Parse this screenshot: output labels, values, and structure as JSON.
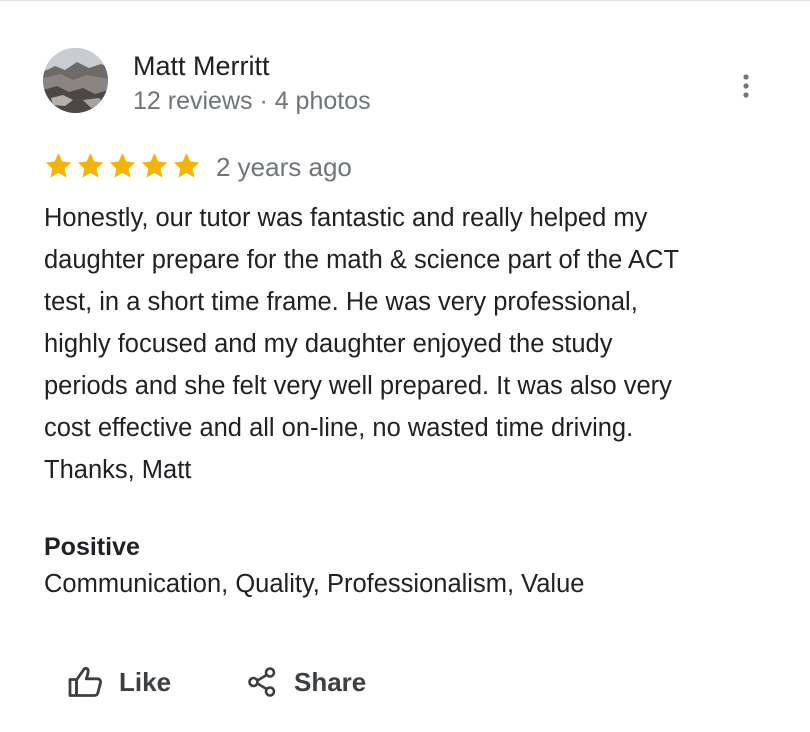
{
  "review": {
    "author": {
      "name": "Matt Merritt",
      "meta": "12 reviews · 4 photos"
    },
    "rating": 5,
    "max_rating": 5,
    "time": "2 years ago",
    "text": "Honestly, our tutor was fantastic and really helped my\ndaughter prepare for the math & science part of the ACT\ntest, in a short time frame.  He was very professional,\nhighly focused and my daughter enjoyed the study\nperiods and she felt very well prepared.  It was also very\ncost effective and all on-line, no wasted time driving.\nThanks, Matt",
    "positive": {
      "heading": "Positive",
      "values": "Communication, Quality, Professionalism, Value"
    }
  },
  "actions": {
    "like_label": "Like",
    "share_label": "Share"
  },
  "icons": {
    "more": "more-vert-icon",
    "star": "star-icon",
    "like": "thumb-up-icon",
    "share": "share-icon"
  },
  "colors": {
    "star": "#f4b400",
    "primary_text": "#202124",
    "secondary_text": "#70757a"
  }
}
